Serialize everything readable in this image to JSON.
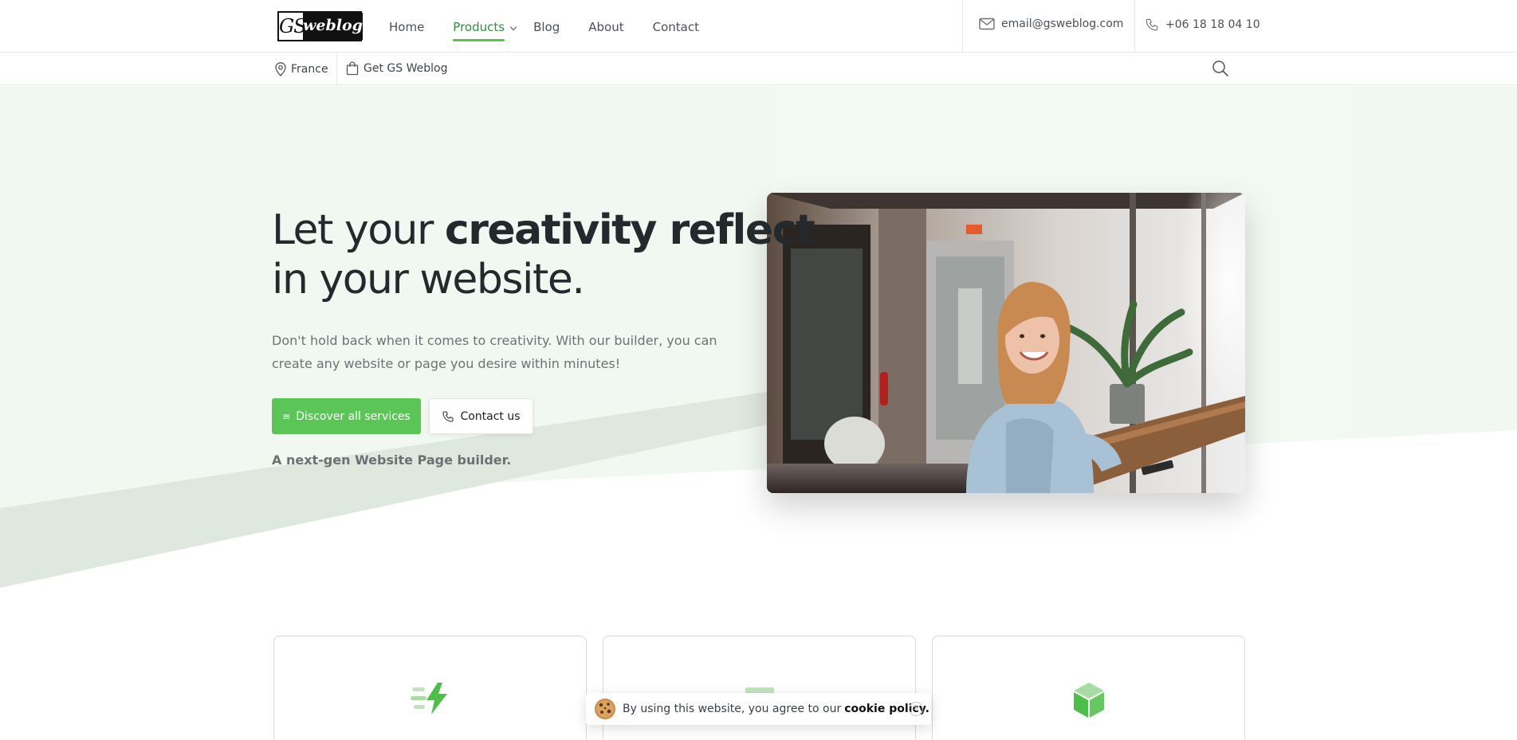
{
  "header": {
    "logo": {
      "left": "GS",
      "right": "weblog"
    },
    "nav": [
      {
        "label": "Home",
        "active": false
      },
      {
        "label": "Products",
        "active": true
      },
      {
        "label": "Blog",
        "active": false
      },
      {
        "label": "About",
        "active": false
      },
      {
        "label": "Contact",
        "active": false
      }
    ],
    "email": "email@gsweblog.com",
    "phone": "+06 18 18 04 10"
  },
  "subheader": {
    "location": "France",
    "store_link": "Get GS Weblog"
  },
  "hero": {
    "headline_pre": "Let your ",
    "headline_highlight": "creativity reflect",
    "headline_post": "in your website.",
    "lede": "Don't hold back when it comes to creativity. With our builder, you can create any website or page you desire within minutes!",
    "primary_button": "Discover all services",
    "secondary_button": "Contact us",
    "tagline": "A next-gen Website Page builder."
  },
  "cookie": {
    "text": "By using this website, you agree to our",
    "link": "cookie policy."
  },
  "colors": {
    "accent": "#5cc558",
    "highlight": "#f5d31a",
    "hero_bg": "#f1f8f1"
  },
  "icons": [
    "email-icon",
    "phone-icon",
    "location-pin-icon",
    "shopping-bag-icon",
    "search-icon",
    "menu-lines-icon",
    "cookie-icon",
    "close-icon",
    "lightning-icon",
    "layout-icon",
    "cube-icon"
  ]
}
